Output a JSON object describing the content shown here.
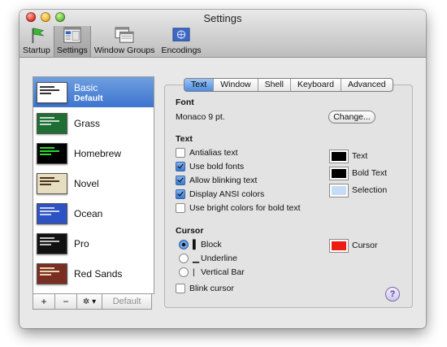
{
  "window": {
    "title": "Settings"
  },
  "toolbar": {
    "items": [
      {
        "label": "Startup",
        "icon": "flag-icon"
      },
      {
        "label": "Settings",
        "icon": "settings-window-icon",
        "selected": true
      },
      {
        "label": "Window Groups",
        "icon": "window-groups-icon"
      },
      {
        "label": "Encodings",
        "icon": "globe-flag-icon"
      }
    ]
  },
  "profiles": {
    "items": [
      {
        "name": "Basic",
        "badge": "Default",
        "selected": true,
        "bg": "#ffffff",
        "fg": "#000000"
      },
      {
        "name": "Grass",
        "bg": "#1f6e34",
        "fg": "#ffe9a0"
      },
      {
        "name": "Homebrew",
        "bg": "#000000",
        "fg": "#2bdb2b"
      },
      {
        "name": "Novel",
        "bg": "#e7ddc0",
        "fg": "#4a3420"
      },
      {
        "name": "Ocean",
        "bg": "#2d52c5",
        "fg": "#ffffff"
      },
      {
        "name": "Pro",
        "bg": "#111111",
        "fg": "#f0f0f0"
      },
      {
        "name": "Red Sands",
        "bg": "#7a2e22",
        "fg": "#e8d6b0"
      }
    ],
    "buttons": {
      "add": "+",
      "remove": "−",
      "gear": "✲ ▾",
      "default": "Default"
    }
  },
  "tabs": [
    {
      "label": "Text",
      "active": true
    },
    {
      "label": "Window"
    },
    {
      "label": "Shell"
    },
    {
      "label": "Keyboard"
    },
    {
      "label": "Advanced"
    }
  ],
  "font": {
    "header": "Font",
    "value": "Monaco 9 pt.",
    "change_button": "Change..."
  },
  "text": {
    "header": "Text",
    "options": [
      {
        "label": "Antialias text",
        "checked": false
      },
      {
        "label": "Use bold fonts",
        "checked": true
      },
      {
        "label": "Allow blinking text",
        "checked": true
      },
      {
        "label": "Display ANSI colors",
        "checked": true
      },
      {
        "label": "Use bright colors for bold text",
        "checked": false
      }
    ],
    "colors": [
      {
        "label": "Text",
        "color": "#000000"
      },
      {
        "label": "Bold Text",
        "color": "#000000"
      },
      {
        "label": "Selection",
        "color": "#c6dcf5"
      }
    ]
  },
  "cursor": {
    "header": "Cursor",
    "options": [
      {
        "glyph": "▌",
        "label": "Block",
        "selected": true
      },
      {
        "glyph": "▁",
        "label": "Underline",
        "selected": false
      },
      {
        "glyph": "|",
        "label": "Vertical Bar",
        "selected": false
      }
    ],
    "blink_label": "Blink cursor",
    "blink_checked": false,
    "color_label": "Cursor",
    "color": "#ee1b13"
  },
  "help": "?"
}
